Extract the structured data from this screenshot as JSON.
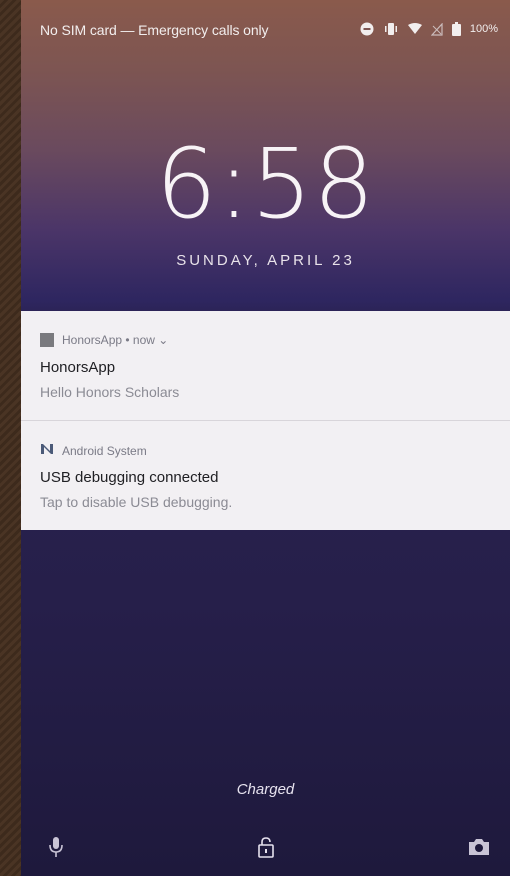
{
  "status_bar": {
    "text": "No SIM card — Emergency calls only",
    "battery": "100%",
    "icons": [
      "do-not-disturb-icon",
      "vibrate-icon",
      "wifi-icon",
      "no-signal-icon",
      "battery-icon"
    ]
  },
  "lockscreen": {
    "time": "6:58",
    "date": "SUNDAY, APRIL 23",
    "charging_status": "Charged"
  },
  "notifications": [
    {
      "app_icon": "app-square-icon",
      "header": "HonorsApp • now ⌄",
      "title": "HonorsApp",
      "body": "Hello Honors Scholars"
    },
    {
      "app_icon": "android-n-icon",
      "header": "Android System",
      "title": "USB debugging connected",
      "body": "Tap to disable USB debugging."
    }
  ],
  "bottom_actions": {
    "left": "mic-icon",
    "center": "unlock-icon",
    "right": "camera-icon"
  },
  "colors": {
    "notification_bg": "#f2f0f3",
    "text_light": "#f7f3f6"
  }
}
